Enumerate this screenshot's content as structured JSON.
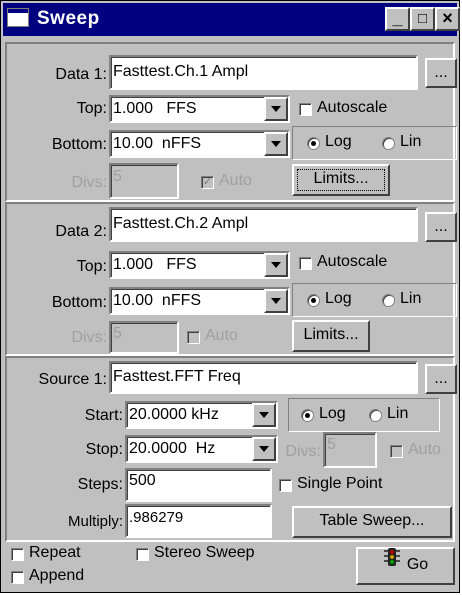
{
  "window": {
    "title": "Sweep",
    "minimize_label": "_",
    "maximize_label": "□",
    "close_label": "×"
  },
  "data1": {
    "label": "Data 1:",
    "value": "Fasttest.Ch.1 Ampl",
    "browse_label": "...",
    "top_label": "Top:",
    "top_value": "1.000   FFS",
    "autoscale_label": "Autoscale",
    "autoscale_checked": false,
    "bottom_label": "Bottom:",
    "bottom_value": "10.00  nFFS",
    "log_label": "Log",
    "lin_label": "Lin",
    "scale": "Log",
    "divs_label": "Divs:",
    "divs_value": "5",
    "auto_label": "Auto",
    "auto_checked": true,
    "limits_label": "Limits..."
  },
  "data2": {
    "label": "Data 2:",
    "value": "Fasttest.Ch.2 Ampl",
    "browse_label": "...",
    "top_label": "Top:",
    "top_value": "1.000   FFS",
    "autoscale_label": "Autoscale",
    "autoscale_checked": false,
    "bottom_label": "Bottom:",
    "bottom_value": "10.00  nFFS",
    "log_label": "Log",
    "lin_label": "Lin",
    "scale": "Log",
    "divs_label": "Divs:",
    "divs_value": "5",
    "auto_label": "Auto",
    "auto_checked": false,
    "limits_label": "Limits..."
  },
  "source1": {
    "label": "Source 1:",
    "value": "Fasttest.FFT Freq",
    "browse_label": "...",
    "start_label": "Start:",
    "start_value": "20.0000 kHz",
    "log_label": "Log",
    "lin_label": "Lin",
    "scale": "Log",
    "stop_label": "Stop:",
    "stop_value": "20.0000  Hz",
    "divs_label": "Divs:",
    "divs_value": "5",
    "auto_label": "Auto",
    "steps_label": "Steps:",
    "steps_value": "500",
    "single_point_label": "Single Point",
    "multiply_label": "Multiply:",
    "multiply_value": ".986279",
    "table_sweep_label": "Table Sweep..."
  },
  "bottom": {
    "repeat_label": "Repeat",
    "stereo_sweep_label": "Stereo Sweep",
    "append_label": "Append",
    "go_label": "Go"
  }
}
